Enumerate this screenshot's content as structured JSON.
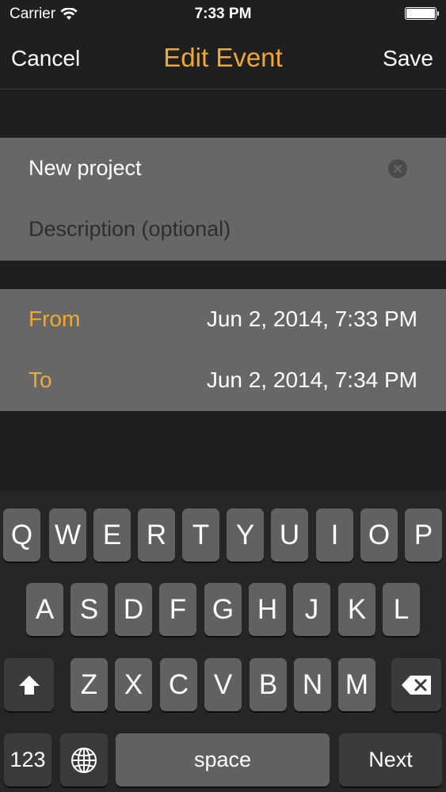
{
  "status": {
    "carrier": "Carrier",
    "time": "7:33 PM",
    "battery_level": 1.0
  },
  "nav": {
    "cancel_label": "Cancel",
    "title": "Edit Event",
    "save_label": "Save"
  },
  "form": {
    "title_value": "New project",
    "description_placeholder": "Description (optional)",
    "from_label": "From",
    "from_value": "Jun 2, 2014, 7:33 PM",
    "to_label": "To",
    "to_value": "Jun 2, 2014, 7:34 PM"
  },
  "keyboard": {
    "row1": [
      "Q",
      "W",
      "E",
      "R",
      "T",
      "Y",
      "U",
      "I",
      "O",
      "P"
    ],
    "row2": [
      "A",
      "S",
      "D",
      "F",
      "G",
      "H",
      "J",
      "K",
      "L"
    ],
    "row3": [
      "Z",
      "X",
      "C",
      "V",
      "B",
      "N",
      "M"
    ],
    "numbers_label": "123",
    "space_label": "space",
    "next_label": "Next"
  },
  "colors": {
    "accent": "#f0a830",
    "background": "#1f1f1f",
    "cell": "#676767"
  }
}
